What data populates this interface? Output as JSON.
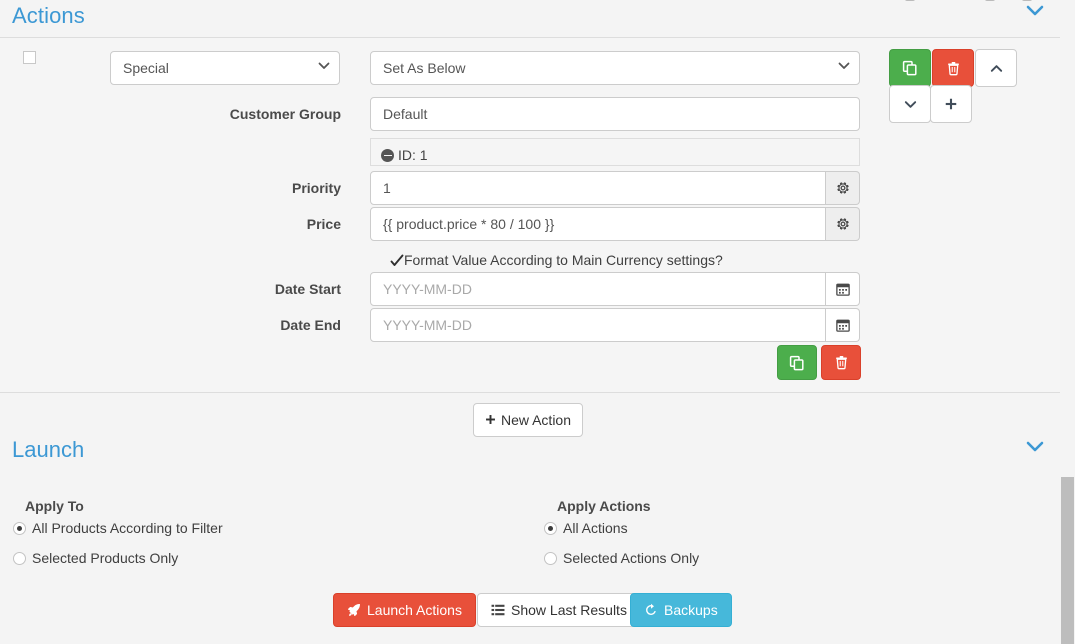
{
  "sections": {
    "actions": {
      "title": "Actions",
      "collapse_icon": "chevron-down-icon"
    },
    "launch": {
      "title": "Launch",
      "collapse_icon": "chevron-down-icon"
    }
  },
  "action_row": {
    "select_checkbox_checked": false,
    "action_type": {
      "value": "Special",
      "options": [
        "Special"
      ]
    },
    "action_mode": {
      "value": "Set As Below",
      "options": [
        "Set As Below"
      ]
    },
    "fields": [
      {
        "label": "Customer Group",
        "value": "Default",
        "placeholder": ""
      },
      {
        "label": "Priority",
        "value": "1",
        "placeholder": ""
      },
      {
        "label": "Price",
        "value": "{{ product.price * 80 / 100 }}",
        "placeholder": ""
      },
      {
        "label": "Date Start",
        "value": "",
        "placeholder": "YYYY-MM-DD"
      },
      {
        "label": "Date End",
        "value": "",
        "placeholder": "YYYY-MM-DD"
      }
    ],
    "customer_group_id": "ID: 1",
    "customer_group_id_icon": "minus-circle-icon",
    "format_currency": {
      "label": "Format Value According to Main Currency settings?",
      "checked": true
    },
    "row_buttons": [
      {
        "name": "copy-action-button",
        "icon": "copy-icon",
        "style": "green"
      },
      {
        "name": "delete-action-button",
        "icon": "trash-icon",
        "style": "red"
      },
      {
        "name": "move-up-button",
        "icon": "chevron-up-icon",
        "style": "white"
      },
      {
        "name": "move-down-button",
        "icon": "chevron-down-icon",
        "style": "white"
      },
      {
        "name": "add-row-button",
        "icon": "plus-icon",
        "style": "white"
      }
    ],
    "field_buttons": [
      {
        "name": "copy-field-button",
        "icon": "copy-icon",
        "style": "green"
      },
      {
        "name": "delete-field-button",
        "icon": "trash-icon",
        "style": "red"
      }
    ],
    "gear_icon": "gear-icon",
    "calendar_icon": "calendar-icon"
  },
  "new_action_button": {
    "label": "New Action",
    "icon": "plus-icon"
  },
  "launch": {
    "apply_to": {
      "group_label": "Apply To",
      "options": [
        {
          "label": "All Products According to Filter",
          "selected": true
        },
        {
          "label": "Selected Products Only",
          "selected": false
        }
      ]
    },
    "apply_actions": {
      "group_label": "Apply Actions",
      "options": [
        {
          "label": "All Actions",
          "selected": true
        },
        {
          "label": "Selected Actions Only",
          "selected": false
        }
      ]
    },
    "buttons": [
      {
        "label": "Launch Actions",
        "icon": "rocket-icon",
        "style": "red"
      },
      {
        "label": "Show Last Results",
        "icon": "list-icon",
        "style": "white"
      },
      {
        "label": "Backups",
        "icon": "history-icon",
        "style": "blue"
      }
    ]
  },
  "colors": {
    "heading_blue": "#3c98d4",
    "green": "#4cae4c",
    "red": "#e8503a",
    "blue": "#46b8da",
    "page_bg": "#f4f4f4"
  }
}
